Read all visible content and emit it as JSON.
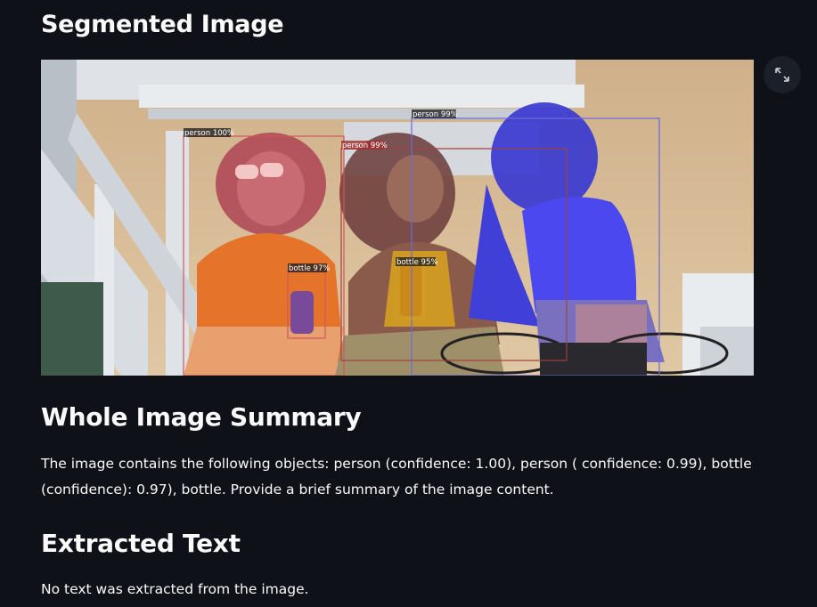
{
  "sections": {
    "segmented_title": "Segmented Image",
    "summary_title": "Whole Image Summary",
    "extracted_title": "Extracted Text"
  },
  "summary_text": "The image contains the following objects: person (confidence: 1.00), person ( confidence: 0.99), bottle (confidence): 0.97), bottle. Provide a brief summary of the image content.",
  "extracted_text": "No text was extracted from the image.",
  "detections": {
    "person_1": "person 100%",
    "person_2": "person 99%",
    "person_3": "person 99%",
    "bottle_1": "bottle 97%",
    "bottle_2": "bottle 95%"
  },
  "icons": {
    "expand": "fullscreen-expand-icon"
  },
  "colors": {
    "background": "#0e1117",
    "text": "#fafafa"
  }
}
